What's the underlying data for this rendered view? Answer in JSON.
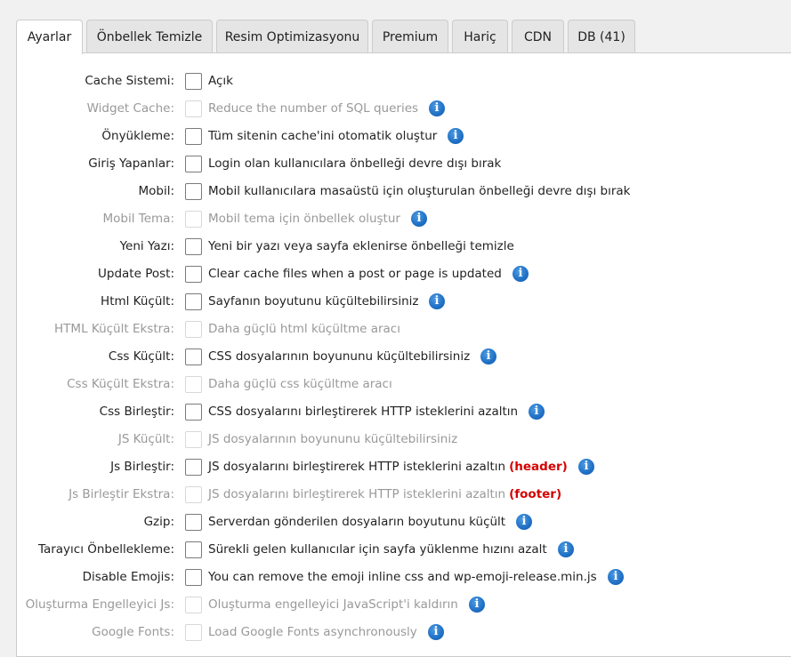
{
  "tabs": [
    {
      "label": "Ayarlar",
      "active": true
    },
    {
      "label": "Önbellek Temizle"
    },
    {
      "label": "Resim Optimizasyonu"
    },
    {
      "label": "Premium"
    },
    {
      "label": "Hariç"
    },
    {
      "label": "CDN"
    },
    {
      "label": "DB (41)"
    }
  ],
  "settings": [
    {
      "label": "Cache Sistemi:",
      "desc": "Açık",
      "enabled": true,
      "info": false,
      "checked": false
    },
    {
      "label": "Widget Cache:",
      "desc": "Reduce the number of SQL queries",
      "enabled": false,
      "info": true,
      "checked": false
    },
    {
      "label": "Önyükleme:",
      "desc": "Tüm sitenin cache'ini otomatik oluştur",
      "enabled": true,
      "info": true,
      "checked": false
    },
    {
      "label": "Giriş Yapanlar:",
      "desc": "Login olan kullanıcılara önbelleği devre dışı bırak",
      "enabled": true,
      "info": false,
      "checked": false
    },
    {
      "label": "Mobil:",
      "desc": "Mobil kullanıcılara masaüstü için oluşturulan önbelleği devre dışı bırak",
      "enabled": true,
      "info": false,
      "checked": false
    },
    {
      "label": "Mobil Tema:",
      "desc": "Mobil tema için önbellek oluştur",
      "enabled": false,
      "info": true,
      "checked": false
    },
    {
      "label": "Yeni Yazı:",
      "desc": "Yeni bir yazı veya sayfa eklenirse önbelleği temizle",
      "enabled": true,
      "info": false,
      "checked": false
    },
    {
      "label": "Update Post:",
      "desc": "Clear cache files when a post or page is updated",
      "enabled": true,
      "info": true,
      "checked": false
    },
    {
      "label": "Html Küçült:",
      "desc": "Sayfanın boyutunu küçültebilirsiniz",
      "enabled": true,
      "info": true,
      "checked": false
    },
    {
      "label": "HTML Küçült Ekstra:",
      "desc": "Daha güçlü html küçültme aracı",
      "enabled": false,
      "info": false,
      "checked": false
    },
    {
      "label": "Css Küçült:",
      "desc": "CSS dosyalarının boyununu küçültebilirsiniz",
      "enabled": true,
      "info": true,
      "checked": false
    },
    {
      "label": "Css Küçült Ekstra:",
      "desc": "Daha güçlü css küçültme aracı",
      "enabled": false,
      "info": false,
      "checked": false
    },
    {
      "label": "Css Birleştir:",
      "desc": "CSS dosyalarını birleştirerek HTTP isteklerini azaltın",
      "enabled": true,
      "info": true,
      "checked": false
    },
    {
      "label": "JS Küçült:",
      "desc": "JS dosyalarının boyununu küçültebilirsiniz",
      "enabled": false,
      "info": false,
      "checked": false
    },
    {
      "label": "Js Birleştir:",
      "desc": "JS dosyalarını birleştirerek HTTP isteklerini azaltın",
      "tag": "(header)",
      "enabled": true,
      "info": true,
      "checked": false
    },
    {
      "label": "Js Birleştir Ekstra:",
      "desc": "JS dosyalarını birleştirerek HTTP isteklerini azaltın",
      "tag": "(footer)",
      "enabled": false,
      "info": false,
      "checked": false
    },
    {
      "label": "Gzip:",
      "desc": "Serverdan gönderilen dosyaların boyutunu küçült",
      "enabled": true,
      "info": true,
      "checked": false
    },
    {
      "label": "Tarayıcı Önbellekleme:",
      "desc": "Sürekli gelen kullanıcılar için sayfa yüklenme hızını azalt",
      "enabled": true,
      "info": true,
      "checked": false
    },
    {
      "label": "Disable Emojis:",
      "desc": "You can remove the emoji inline css and wp-emoji-release.min.js",
      "enabled": true,
      "info": true,
      "checked": false
    },
    {
      "label": "Oluşturma Engelleyici Js:",
      "desc": "Oluşturma engelleyici JavaScript'i kaldırın",
      "enabled": false,
      "info": true,
      "checked": false
    },
    {
      "label": "Google Fonts:",
      "desc": "Load Google Fonts asynchronously",
      "enabled": false,
      "info": true,
      "checked": false
    }
  ],
  "info_glyph": "i",
  "colors": {
    "accent": "#1f6fc5",
    "tag": "#d40000",
    "disabled": "#999999"
  }
}
